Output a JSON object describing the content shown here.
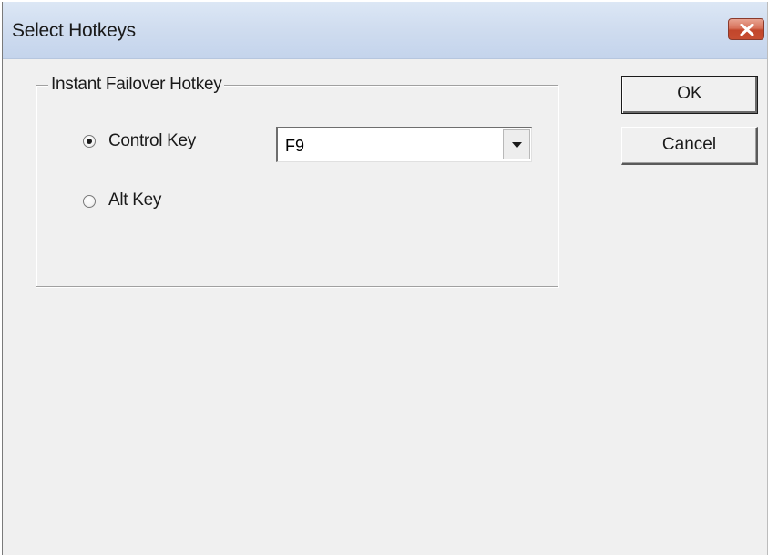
{
  "window": {
    "title": "Select Hotkeys",
    "close_icon": "close-icon"
  },
  "group": {
    "label": "Instant Failover Hotkey"
  },
  "options": {
    "control": {
      "label": "Control Key",
      "selected": true
    },
    "alt": {
      "label": "Alt Key",
      "selected": false
    }
  },
  "hotkey_select": {
    "value": "F9",
    "arrow_icon": "chevron-down-icon"
  },
  "buttons": {
    "ok": "OK",
    "cancel": "Cancel"
  },
  "colors": {
    "titlebar": "#cfdcef",
    "close_button": "#c74d31",
    "dialog_bg": "#f0f0f0"
  }
}
